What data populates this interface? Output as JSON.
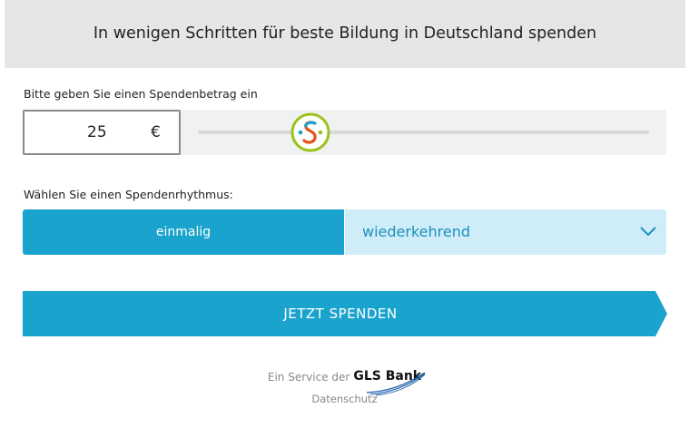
{
  "header": {
    "title": "In wenigen Schritten für beste Bildung in Deutschland spenden"
  },
  "amount": {
    "label": "Bitte geben Sie einen Spendenbetrag ein",
    "value": "25",
    "currency": "€",
    "slider_level": 0.25
  },
  "rhythm": {
    "label": "Wählen Sie einen Spendenrhythmus:",
    "once": "einmalig",
    "recurring": "wiederkehrend",
    "selected": "einmalig"
  },
  "donate": {
    "label": "JETZT SPENDEN"
  },
  "footer": {
    "service_prefix": "Ein Service der",
    "bank": "GLS Bank",
    "privacy": "Datenschutz"
  },
  "colors": {
    "primary": "#1aa3cc",
    "secondary_bg": "#cfedf8",
    "header_bg": "#e6e6e6",
    "handle_ring": "#9bc31c"
  }
}
